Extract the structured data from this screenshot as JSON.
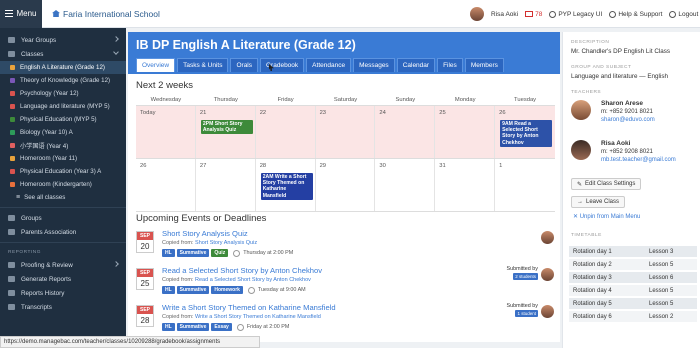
{
  "topbar": {
    "menu_label": "Menu",
    "school_name": "Faria International School",
    "user_name": "Risa Aoki",
    "mail_count": "78",
    "pyp_label": "PYP Legacy UI",
    "help_label": "Help & Support",
    "logout_label": "Logout"
  },
  "sidebar": {
    "year_groups": "Year Groups",
    "classes": "Classes",
    "class_items": [
      {
        "label": "English A Literature (Grade 12)",
        "color": "#e8a23c"
      },
      {
        "label": "Theory of Knowledge (Grade 12)",
        "color": "#7b57b8"
      },
      {
        "label": "Psychology (Year 12)",
        "color": "#d9534f"
      },
      {
        "label": "Language and literature (MYP 5)",
        "color": "#d9534f"
      },
      {
        "label": "Physical Education (MYP 5)",
        "color": "#3d8a3a"
      },
      {
        "label": "Biology (Year 10) A",
        "color": "#2d9c5a"
      },
      {
        "label": "小学国语 (Year 4)",
        "color": "#e06060"
      },
      {
        "label": "Homeroom (Year 11)",
        "color": "#e8a23c"
      },
      {
        "label": "Physical Education (Year 3) A",
        "color": "#d9534f"
      },
      {
        "label": "Homeroom (Kindergarten)",
        "color": "#e8703c"
      }
    ],
    "see_all": "See all classes",
    "groups": "Groups",
    "parents": "Parents Association",
    "reporting_header": "REPORTING",
    "proofing": "Proofing & Review",
    "generate": "Generate Reports",
    "history": "Reports History",
    "transcripts": "Transcripts"
  },
  "course": {
    "title": "IB DP English A Literature (Grade 12)",
    "tabs": [
      "Overview",
      "Tasks & Units",
      "Orals",
      "Gradebook",
      "Attendance",
      "Messages",
      "Calendar",
      "Files",
      "Members"
    ]
  },
  "calendar": {
    "heading": "Next 2 weeks",
    "days": [
      "Wednesday",
      "Thursday",
      "Friday",
      "Saturday",
      "Sunday",
      "Monday",
      "Tuesday"
    ],
    "week1": [
      "Today",
      "21",
      "22",
      "23",
      "24",
      "25",
      "26"
    ],
    "week2": [
      "26",
      "27",
      "28",
      "29",
      "30",
      "31",
      "1"
    ],
    "events": {
      "e1": "2PM Short Story Analysis Quiz",
      "e2": "9AM Read a Selected Short Story by Anton Chekhov",
      "e3": "2AM Write a Short Story Themed on Katharine Mansfield"
    },
    "event_badge_count": "0"
  },
  "upcoming": {
    "heading": "Upcoming Events or Deadlines",
    "copied_prefix": "Copied from:",
    "items": [
      {
        "month": "SEP",
        "day": "20",
        "title": "Short Story Analysis Quiz",
        "copied": "Short Story Analysis Quiz",
        "tags": [
          "HL",
          "Summative",
          "Quiz"
        ],
        "time": "Thursday at 2:00 PM",
        "submitted": "",
        "students": ""
      },
      {
        "month": "SEP",
        "day": "25",
        "title": "Read a Selected Short Story by Anton Chekhov",
        "copied": "Read a Selected Short Story by Anton Chekhov",
        "tags": [
          "HL",
          "Summative",
          "Homework"
        ],
        "time": "Tuesday at 9:00 AM",
        "submitted": "Submitted by",
        "students": "2 students"
      },
      {
        "month": "SEP",
        "day": "28",
        "title": "Write a Short Story Themed on Katharine Mansfield",
        "copied": "Write a Short Story Themed on Katharine Mansfield",
        "tags": [
          "HL",
          "Summative",
          "Essay"
        ],
        "time": "Friday at 2:00 PM",
        "submitted": "Submitted by",
        "students": "1 student"
      }
    ]
  },
  "right": {
    "description_label": "DESCRIPTION",
    "description": "Mr. Chandler's DP English Lit Class",
    "group_label": "GROUP AND SUBJECT",
    "group": "Language and literature — English",
    "teachers_label": "TEACHERS",
    "teachers": [
      {
        "name": "Sharon Arese",
        "phone": "m: +852 9201 8021",
        "email": "sharon@eduvo.com"
      },
      {
        "name": "Risa Aoki",
        "phone": "m: +852 9208 8021",
        "email": "mb.test.teacher@gmail.com"
      }
    ],
    "edit_btn": "Edit Class Settings",
    "leave_btn": "Leave Class",
    "unpin": "Unpin from Main Menu",
    "timetable_label": "TIMETABLE",
    "timetable": [
      [
        "Rotation day 1",
        "Lesson 3"
      ],
      [
        "Rotation day 2",
        "Lesson 5"
      ],
      [
        "Rotation day 3",
        "Lesson 6"
      ],
      [
        "Rotation day 4",
        "Lesson 5"
      ],
      [
        "Rotation day 5",
        "Lesson 5"
      ],
      [
        "Rotation day 6",
        "Lesson 2"
      ]
    ]
  },
  "status_url": "https://demo.managebac.com/teacher/classes/10209288/gradebook/assignments"
}
